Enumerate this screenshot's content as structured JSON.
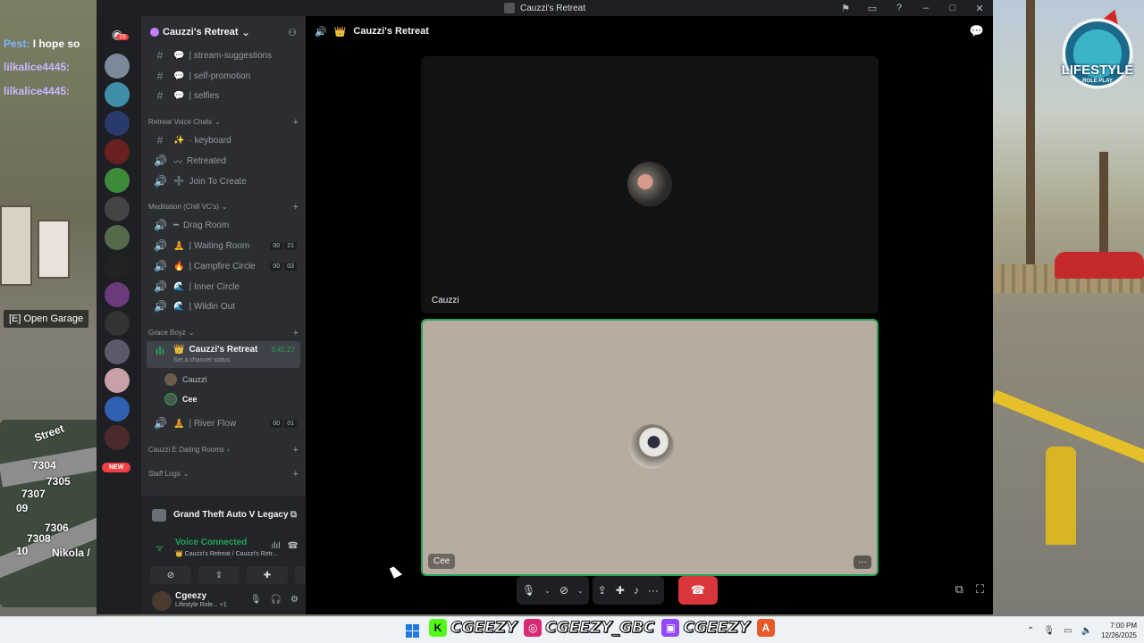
{
  "game": {
    "chat": [
      {
        "name": "Pest:",
        "text": "I hope so",
        "color": "#7fb2ff"
      },
      {
        "name": "lilkalice4445:",
        "text": "",
        "color": "#c9b8ff"
      },
      {
        "name": "lilkalice4445:",
        "text": "",
        "color": "#c9b8ff"
      }
    ],
    "open_garage": "[E] Open Garage",
    "minimap_numbers": [
      "7304",
      "7305",
      "7307",
      "09",
      "7306",
      "7308",
      "10",
      "Nikola /",
      "Street"
    ],
    "logo_text": "LIFESTYLE",
    "logo_sub": "ROLE PLAY"
  },
  "titlebar": {
    "title": "Cauzzi's Retreat",
    "icons": [
      "inbox-icon",
      "monitor-icon",
      "help-icon",
      "minimize-icon",
      "maximize-icon",
      "close-icon"
    ]
  },
  "servers": {
    "badge": "15",
    "new_label": "NEW"
  },
  "sidebar": {
    "server_name": "Cauzzi's Retreat",
    "channels_top": [
      {
        "icon": "#",
        "emoji": "💬",
        "label": "| stream-suggestions"
      },
      {
        "icon": "#",
        "emoji": "💬",
        "label": "| self-promotion"
      },
      {
        "icon": "#",
        "emoji": "💬",
        "label": "| selfies"
      }
    ],
    "cat_voice": "Retreat Voice Chats",
    "voice_channels": [
      {
        "icon": "#",
        "emoji": "✨",
        "label": "· keyboard"
      },
      {
        "icon": "🔊",
        "emoji": "〰",
        "label": "Retreated"
      },
      {
        "icon": "🔊",
        "emoji": "➕",
        "label": "Join To Create"
      }
    ],
    "cat_meditation": "Meditation (Chill VC's)",
    "meditation_channels": [
      {
        "icon": "🔊",
        "emoji": "━",
        "label": "Drag Room",
        "count": []
      },
      {
        "icon": "🔊",
        "emoji": "🧘",
        "label": "| Waiting Room",
        "count": [
          "00",
          "21"
        ]
      },
      {
        "icon": "🔊",
        "emoji": "🔥",
        "label": "| Campfire Circle",
        "count": [
          "00",
          "03"
        ]
      },
      {
        "icon": "🔊",
        "emoji": "🌊",
        "label": "| Inner Circle",
        "count": []
      },
      {
        "icon": "🔊",
        "emoji": "🌊",
        "label": "| Wildin Out",
        "count": []
      }
    ],
    "cat_grace": "Grace Boyz",
    "active_channel": {
      "emoji": "👑",
      "label": "Cauzzi's Retreat",
      "timer": "3:41:27",
      "status": "Set a channel status"
    },
    "members": [
      {
        "name": "Cauzzi",
        "bold": false
      },
      {
        "name": "Cee",
        "bold": true
      }
    ],
    "river_flow": {
      "emoji": "🧘",
      "label": "| River Flow",
      "count": [
        "00",
        "01"
      ]
    },
    "cat_dating": "Cauzzi E Dating Rooms",
    "cat_staff": "Staff Logs"
  },
  "activity": {
    "game": "Grand Theft Auto V Legacy"
  },
  "voice": {
    "status": "Voice Connected",
    "channel_path": "👑 Cauzzi's Retreat / Cauzzi's Retr..."
  },
  "user": {
    "name": "Cgeezy",
    "status": "Lifestyle Role... +1"
  },
  "main": {
    "header_title": "Cauzzi's Retreat",
    "tile1_name": "Cauzzi",
    "tile2_name": "Cee",
    "more_label": "···"
  },
  "taskbar": {
    "socials": [
      {
        "icon": "kick-icon",
        "glyph": "K",
        "color": "#53fc18",
        "text": "CGEEZY"
      },
      {
        "icon": "instagram-icon",
        "glyph": "◎",
        "color": "#d62976",
        "text": "CGEEZY_GBC"
      },
      {
        "icon": "twitch-icon",
        "glyph": "▣",
        "color": "#9146ff",
        "text": "CGEEZY"
      }
    ],
    "time": "7:00 PM",
    "date": "12/26/2025"
  }
}
